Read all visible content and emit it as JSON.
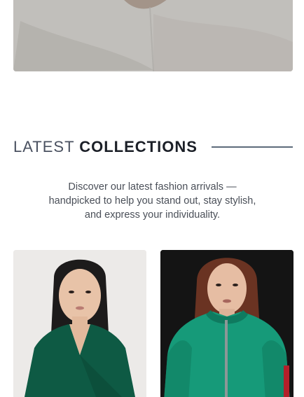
{
  "section": {
    "heading_light": "LATEST",
    "heading_bold": "COLLECTIONS",
    "description": "Discover our latest fashion arrivals — handpicked to help you stand out, stay stylish, and express your individuality."
  },
  "products": [
    {
      "image": "model-green-wrap-dress-photo"
    },
    {
      "image": "model-green-bomber-jacket-photo"
    }
  ],
  "colors": {
    "accent_green": "#0e5a44",
    "jacket_green": "#169a79",
    "heading_dark": "#1b1f27",
    "divider": "#5d6b7a"
  }
}
